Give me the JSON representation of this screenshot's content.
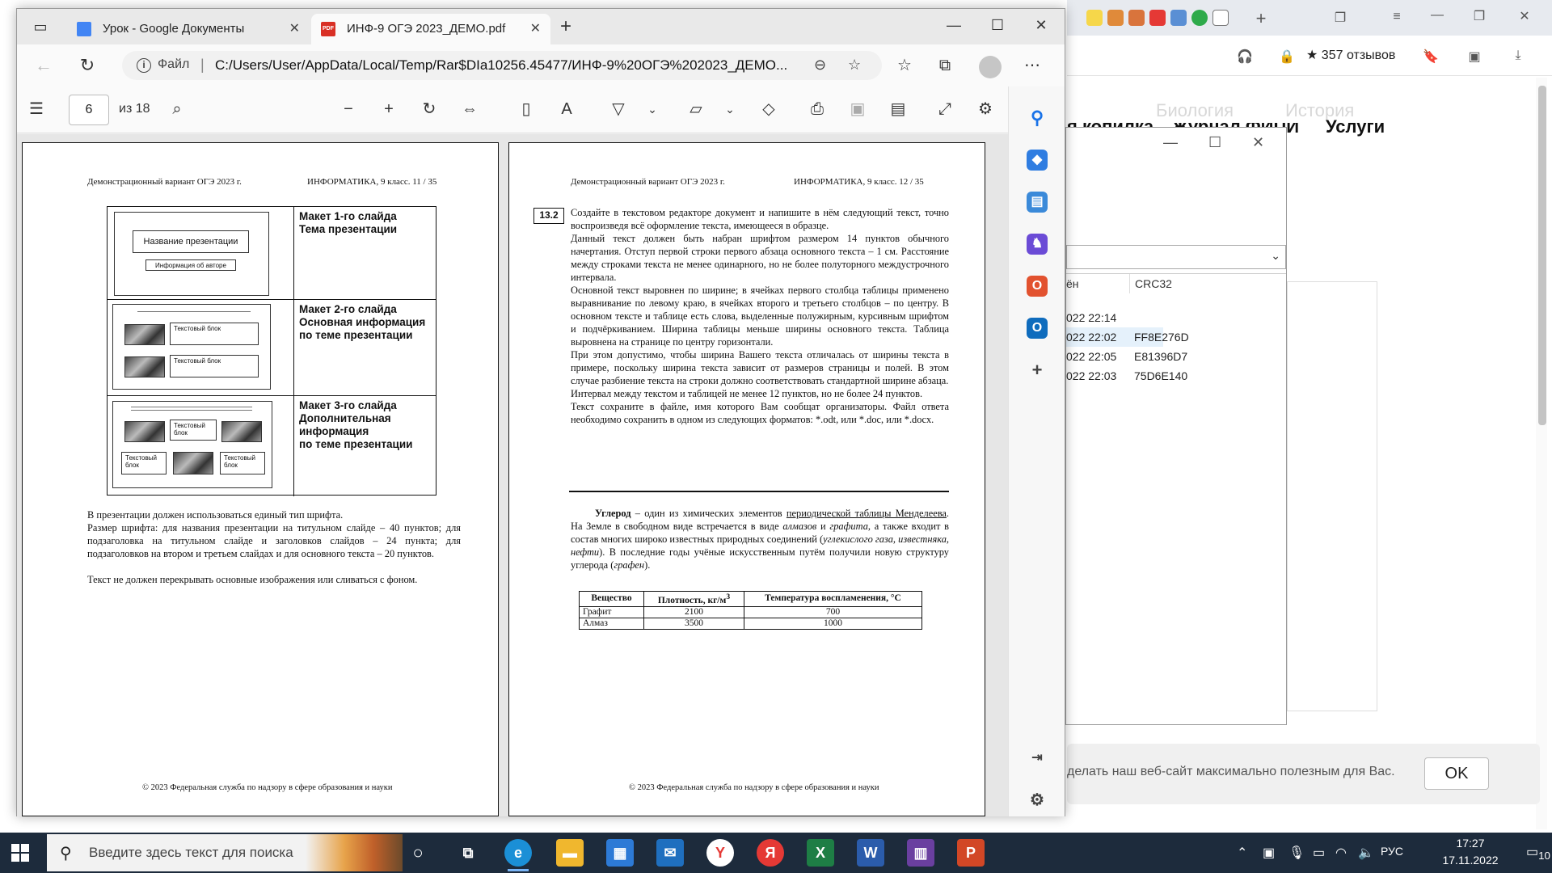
{
  "bg_browser": {
    "reviews": "357 отзывов",
    "nav": [
      "Биология",
      "История",
      "я копилка",
      "Журнал ФИПИ",
      "Услуги"
    ],
    "cookie_text": "делать наш веб-сайт максимально полезным для Вас.",
    "ok_label": "OK"
  },
  "archive": {
    "col_name": "ён",
    "col_crc": "CRC32",
    "rows": [
      {
        "date": "022 22:14",
        "crc": ""
      },
      {
        "date": "022 22:02",
        "crc": "FF8E276D"
      },
      {
        "date": "022 22:05",
        "crc": "E81396D7"
      },
      {
        "date": "022 22:03",
        "crc": "75D6E140"
      }
    ]
  },
  "edge": {
    "tabs": [
      {
        "title": "Урок - Google Документы"
      },
      {
        "title": "ИНФ-9 ОГЭ 2023_ДЕМО.pdf"
      }
    ],
    "address": {
      "scheme": "Файл",
      "url": "C:/Users/User/AppData/Local/Temp/Rar$DIa10256.45477/ИНФ-9%20ОГЭ%202023_ДЕМО..."
    },
    "pdf": {
      "page": "6",
      "total": "из 18"
    }
  },
  "left_page": {
    "header_left": "Демонстрационный вариант ОГЭ 2023 г.",
    "header_right": "ИНФОРМАТИКА, 9 класс.    11 / 35",
    "slides": [
      {
        "desc": "Макет 1-го слайда\nТема презентации",
        "title_box": "Название презентации",
        "author_box": "Информация об авторе"
      },
      {
        "desc": "Макет 2-го слайда\nОсновная  информация\nпо теме презентации",
        "box": "Текстовый блок"
      },
      {
        "desc": "Макет 3-го слайда\nДополнительная\nинформация\nпо теме презентации",
        "box": "Текстовый\nблок"
      }
    ],
    "paragraphs": [
      "В презентации должен использоваться единый тип шрифта.",
      "Размер шрифта: для названия презентации на титульном слайде – 40 пунктов; для подзаголовка на титульном слайде и заголовков слайдов – 24 пункта; для подзаголовков на втором и третьем слайдах и для основного текста – 20 пунктов.",
      "Текст не должен перекрывать основные изображения или сливаться с фоном."
    ],
    "footer": "© 2023 Федеральная служба по надзору в сфере образования и науки"
  },
  "right_page": {
    "header_left": "Демонстрационный вариант ОГЭ 2023 г.",
    "header_right": "ИНФОРМАТИКА, 9 класс.    12 / 35",
    "task_number": "13.2",
    "task_text": "Создайте в текстовом редакторе документ и напишите в нём следующий текст, точно воспроизведя всё оформление текста, имеющееся в образце.\nДанный текст должен быть набран шрифтом размером 14 пунктов обычного начертания. Отступ первой строки первого абзаца основного текста – 1 см. Расстояние между строками текста не менее одинарного, но не более полуторного междустрочного интервала.\nОсновной текст выровнен по ширине; в ячейках первого столбца таблицы применено выравнивание по левому краю, в ячейках второго и третьего столбцов – по центру. В основном тексте и таблице есть слова, выделенные полужирным, курсивным шрифтом и подчёркиванием. Ширина таблицы меньше ширины основного текста. Таблица выровнена на странице по центру горизонтали.\nПри этом допустимо, чтобы ширина Вашего текста отличалась от ширины текста в примере, поскольку ширина текста зависит от размеров страницы и полей. В этом случае разбиение текста на строки должно соответствовать стандартной ширине абзаца.\nИнтервал между текстом и таблицей не менее 12 пунктов, но не более 24 пунктов.\nТекст сохраните в файле, имя которого Вам сообщат организаторы. Файл ответа необходимо сохранить в одном из следующих форматов: *.odt, или *.doc, или *.docx.",
    "sample": {
      "term": "Углерод",
      "t1": " – один из химических элементов ",
      "link": "периодической таблицы Менделеева",
      "t2": ". На Земле в свободном виде встречается в виде ",
      "i1": "алмазов",
      "t3": " и ",
      "i2": "графита",
      "t4": ", а также входит в состав многих широко известных природных соединений (",
      "i3": "углекислого газа, известняка, нефти",
      "t5": "). В последние годы учёные искусственным путём получили новую структуру углерода (",
      "i4": "графен",
      "t6": ")."
    },
    "table": {
      "headers": [
        "Вещество",
        "Плотность, кг/м",
        "Температура воспламенения, °С"
      ],
      "header_sup": "3",
      "rows": [
        [
          "Графит",
          "2100",
          "700"
        ],
        [
          "Алмаз",
          "3500",
          "1000"
        ]
      ]
    },
    "footer": "© 2023 Федеральная служба по надзору в сфере образования и науки"
  },
  "taskbar": {
    "search_placeholder": "Введите здесь текст для поиска",
    "lang": "РУС",
    "time": "17:27",
    "date": "17.11.2022",
    "notifications": "10"
  }
}
